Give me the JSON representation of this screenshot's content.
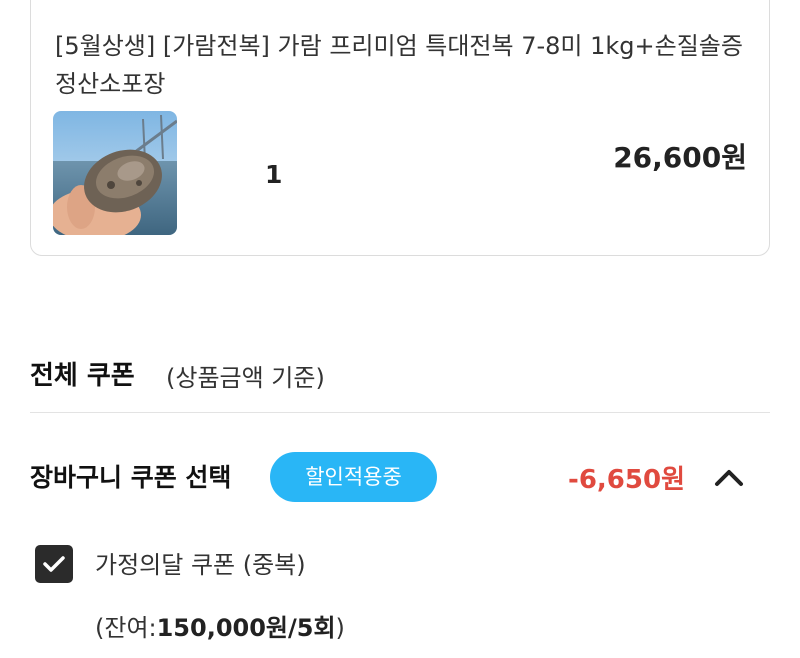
{
  "product": {
    "title": "[5월상생] [가람전복] 가람 프리미엄 특대전복 7-8미 1kg+손질솔증정산소포장",
    "quantity": "1",
    "price": "26,600원",
    "thumbnail_icon": "abalone-photo"
  },
  "coupon_section": {
    "title": "전체 쿠폰",
    "subtitle": "(상품금액 기준)",
    "cart_coupon_label": "장바구니 쿠폰 선택",
    "applied_badge": "할인적용중",
    "discount_amount": "-6,650원",
    "toggle_icon": "chevron-up-icon",
    "coupon": {
      "name": "가정의달 쿠폰 (중복)",
      "checked": true,
      "remaining_prefix": "(잔여:",
      "remaining_value": "150,000원/5회",
      "remaining_suffix": ")"
    }
  },
  "colors": {
    "accent": "#29b6f6",
    "discount": "#e04a3f",
    "checkbox": "#2b2b2b"
  }
}
